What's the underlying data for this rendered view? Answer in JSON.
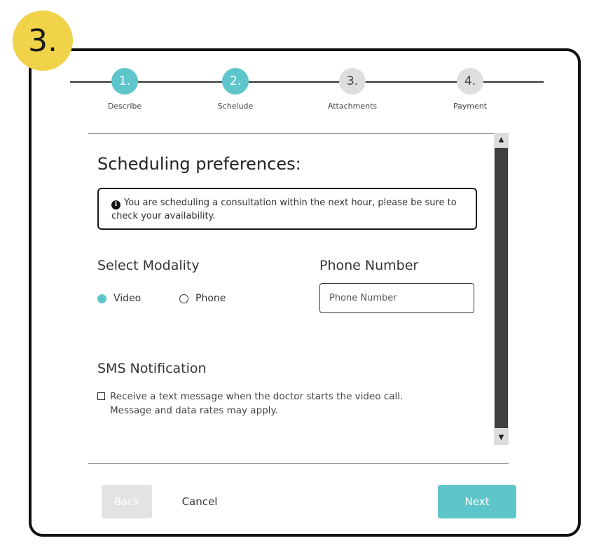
{
  "step_badge": "3.",
  "stepper": {
    "steps": [
      {
        "number": "1.",
        "label": "Describe",
        "state": "active"
      },
      {
        "number": "2.",
        "label": "Schelude",
        "state": "active"
      },
      {
        "number": "3.",
        "label": "Attachments",
        "state": "inactive"
      },
      {
        "number": "4.",
        "label": "Payment",
        "state": "inactive"
      }
    ]
  },
  "form": {
    "title": "Scheduling preferences:",
    "info_message": "You are scheduling a consultation within the next hour, please be sure to check your availability.",
    "modality": {
      "title": "Select Modality",
      "options": [
        {
          "label": "Video",
          "selected": true
        },
        {
          "label": "Phone",
          "selected": false
        }
      ]
    },
    "phone": {
      "title": "Phone Number",
      "placeholder": "Phone Number",
      "value": ""
    },
    "sms": {
      "title": "SMS Notification",
      "checkbox_line1": "Receive a text message when the doctor starts the video call.",
      "checkbox_line2": "Message and data rates may apply.",
      "checked": false
    }
  },
  "footer": {
    "back_label": "Back",
    "cancel_label": "Cancel",
    "next_label": "Next"
  },
  "colors": {
    "accent": "#5ec6cb",
    "badge": "#f1d34a",
    "inactive_step": "#dedede"
  }
}
